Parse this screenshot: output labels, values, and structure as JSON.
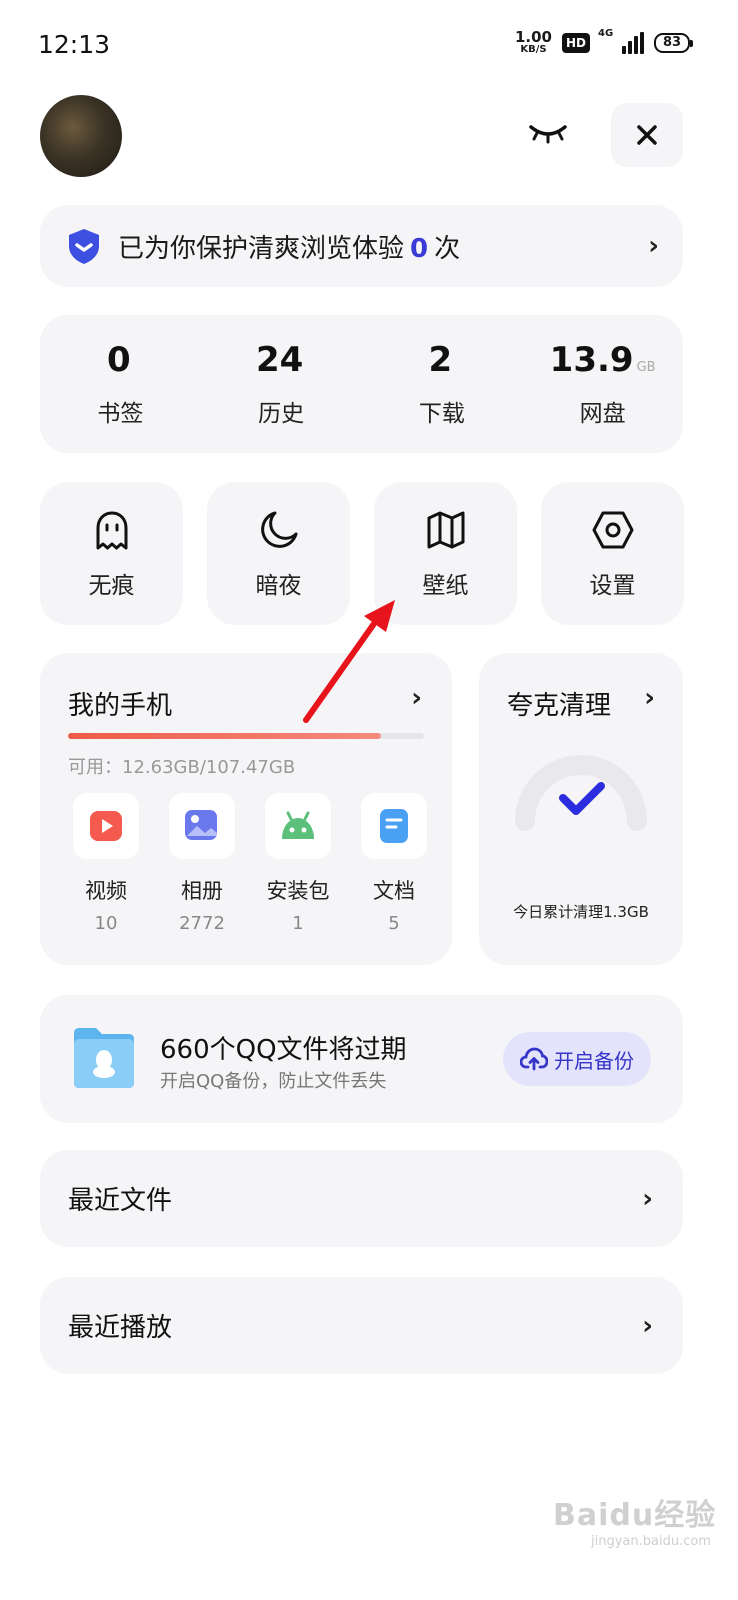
{
  "status_bar": {
    "time": "12:13",
    "net_speed_value": "1.00",
    "net_speed_unit": "KB/S",
    "hd_badge": "HD",
    "signal_label": "4G",
    "battery": "83"
  },
  "protection": {
    "text_prefix": "已为你保护清爽浏览体验",
    "count": "0",
    "text_suffix": "次"
  },
  "stats": [
    {
      "value": "0",
      "unit": "",
      "label": "书签"
    },
    {
      "value": "24",
      "unit": "",
      "label": "历史"
    },
    {
      "value": "2",
      "unit": "",
      "label": "下载"
    },
    {
      "value": "13.9",
      "unit": "GB",
      "label": "网盘"
    }
  ],
  "tiles": [
    {
      "label": "无痕",
      "icon": "ghost-icon"
    },
    {
      "label": "暗夜",
      "icon": "moon-icon"
    },
    {
      "label": "壁纸",
      "icon": "wallpaper-icon"
    },
    {
      "label": "设置",
      "icon": "settings-hexagon-icon"
    }
  ],
  "my_phone": {
    "title": "我的手机",
    "storage_text": "可用：12.63GB/107.47GB",
    "storage_used_fraction": 0.88,
    "apps": [
      {
        "name": "视频",
        "count": "10",
        "icon": "video-icon"
      },
      {
        "name": "相册",
        "count": "2772",
        "icon": "album-icon"
      },
      {
        "name": "安装包",
        "count": "1",
        "icon": "android-icon"
      },
      {
        "name": "文档",
        "count": "5",
        "icon": "document-icon"
      }
    ]
  },
  "cleaner": {
    "title": "夸克清理",
    "subtitle": "今日累计清理1.3GB"
  },
  "qq_backup": {
    "title": "660个QQ文件将过期",
    "subtitle": "开启QQ备份，防止文件丢失",
    "button": "开启备份"
  },
  "recent_files": {
    "label": "最近文件"
  },
  "recent_play": {
    "label": "最近播放"
  },
  "watermark": {
    "text": "Baidu经验",
    "sub": "jingyan.baidu.com"
  },
  "colors": {
    "accent": "#3a3ad6",
    "card_bg": "#f5f5f7",
    "storage_bar": "#ee5b48",
    "annotation_arrow": "#e8141b"
  }
}
